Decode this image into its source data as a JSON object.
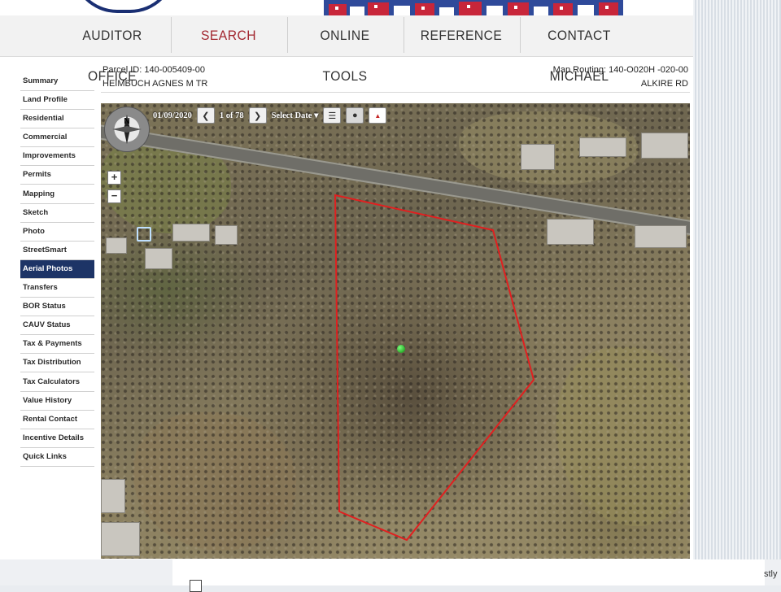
{
  "nav": {
    "items": [
      {
        "label": "AUDITOR OFFICE",
        "active": false
      },
      {
        "label": "SEARCH",
        "active": true
      },
      {
        "label": "ONLINE TOOLS",
        "active": false
      },
      {
        "label": "REFERENCE",
        "active": false
      },
      {
        "label": "CONTACT MICHAEL",
        "active": false
      }
    ]
  },
  "sidebar": {
    "items": [
      {
        "label": "Summary"
      },
      {
        "label": "Land Profile"
      },
      {
        "label": "Residential"
      },
      {
        "label": "Commercial"
      },
      {
        "label": "Improvements"
      },
      {
        "label": "Permits"
      },
      {
        "label": "Mapping"
      },
      {
        "label": "Sketch"
      },
      {
        "label": "Photo"
      },
      {
        "label": "StreetSmart"
      },
      {
        "label": "Aerial Photos",
        "active": true
      },
      {
        "label": "Transfers"
      },
      {
        "label": "BOR Status"
      },
      {
        "label": "CAUV Status"
      },
      {
        "label": "Tax & Payments"
      },
      {
        "label": "Tax Distribution"
      },
      {
        "label": "Tax Calculators"
      },
      {
        "label": "Value History"
      },
      {
        "label": "Rental Contact"
      },
      {
        "label": "Incentive Details"
      },
      {
        "label": "Quick Links"
      }
    ]
  },
  "parcel": {
    "id_text": "Parcel ID: 140-005409-00",
    "routing_text": "Map Routing: 140-O020H   -020-00",
    "owner": "HEIMBUCH AGNES M TR",
    "street": "ALKIRE RD"
  },
  "map": {
    "date": "01/09/2020",
    "page_text": "1 of 78",
    "select_date_label": "Select Date ▾",
    "compass_north": "N",
    "zoom_in": "+",
    "zoom_out": "−",
    "prev_icon": "chevron-left-icon",
    "next_icon": "chevron-right-icon",
    "layers_icon": "layers-icon",
    "pin_icon": "pin-icon",
    "pdf_icon": "pdf-icon",
    "parcel_outline_color": "#e02020",
    "marker_color": "#1fae1f"
  },
  "bottom": {
    "text_right": "stly"
  },
  "colors": {
    "nav_active": "#a2262f",
    "sidebar_active_bg": "#1d3466",
    "banner_blue": "#2f4a9a",
    "logo_navy": "#1a2f73"
  }
}
